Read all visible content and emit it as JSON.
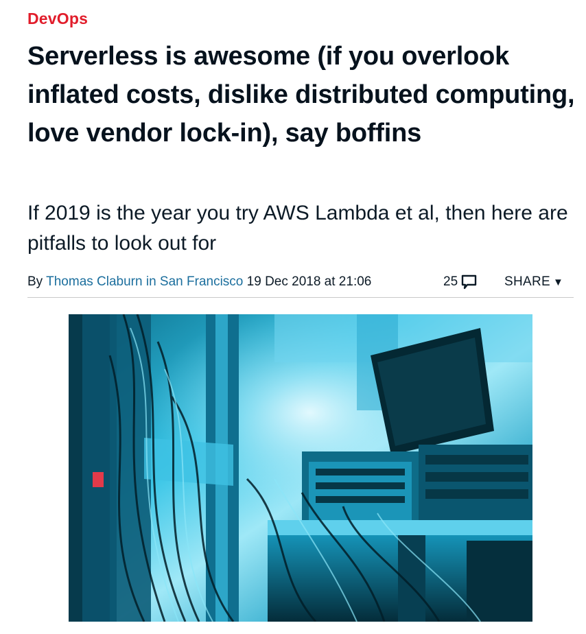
{
  "section": {
    "label": "DevOps",
    "color": "#e11d2b"
  },
  "article": {
    "headline": "Serverless is awesome (if you overlook inflated costs, dislike distributed computing, love vendor lock-in), say boffins",
    "standfirst": "If 2019 is the year you try AWS Lambda et al, then here are pitfalls to look out for",
    "byline": {
      "by": "By",
      "author_location": "Thomas Claburn in San Francisco",
      "date": "19 Dec 2018 at 21:06",
      "comment_count": "25",
      "comment_icon": "speech-bubble-icon",
      "share_label": "SHARE",
      "share_icon": "triangle-down-icon"
    },
    "hero_image": {
      "subject": "server rack cables and network equipment, cyan tint",
      "tint": "#1aa6c9"
    }
  },
  "colors": {
    "link": "#1b6e9d",
    "text": "#0c1a26",
    "rule": "#c9c9c9"
  }
}
